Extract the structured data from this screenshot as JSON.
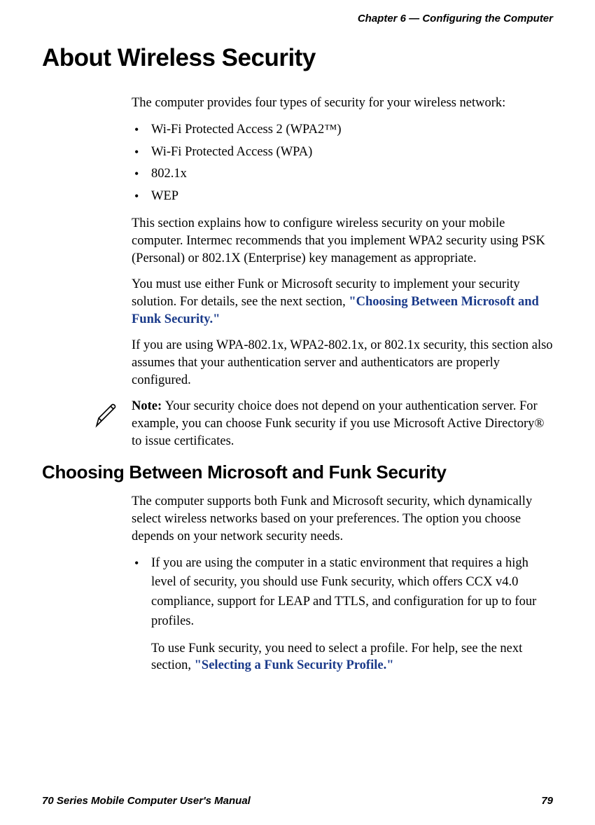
{
  "header": {
    "chapter": "Chapter 6 — Configuring the Computer"
  },
  "section1": {
    "title": "About Wireless Security",
    "intro": "The computer provides four types of security for your wireless network:",
    "bullets": [
      "Wi-Fi Protected Access 2 (WPA2™)",
      "Wi-Fi Protected Access (WPA)",
      "802.1x",
      "WEP"
    ],
    "para2": "This section explains how to configure wireless security on your mobile computer. Intermec recommends that you implement WPA2 security using PSK (Personal) or 802.1X (Enterprise) key management as appropriate.",
    "para3_prefix": "You must use either Funk or Microsoft security to implement your security solution. For details, see the next section, ",
    "para3_link": "\"Choosing Between Microsoft and Funk Security.\"",
    "para4": "If you are using WPA-802.1x, WPA2-802.1x, or 802.1x security, this section also assumes that your authentication server and authenticators are properly configured.",
    "note_label": "Note:  ",
    "note_body": "Your security choice does not depend on your authentication server. For example, you can choose Funk security if you use Microsoft Active Directory® to issue certificates."
  },
  "section2": {
    "title": "Choosing Between Microsoft and Funk Security",
    "para1": "The computer supports both Funk and Microsoft security, which dynamically select wireless networks based on your preferences. The option you choose depends on your network security needs.",
    "bullet1": "If you are using the computer in a static environment that requires a high level of security, you should use Funk security, which offers CCX v4.0 compliance, support for LEAP and TTLS, and configuration for up to four profiles.",
    "followup_prefix": "To use Funk security, you need to select a profile. For help, see the next section, ",
    "followup_link": "\"Selecting a Funk Security Profile.\""
  },
  "footer": {
    "manual": "70 Series Mobile Computer User's Manual",
    "page": "79"
  }
}
